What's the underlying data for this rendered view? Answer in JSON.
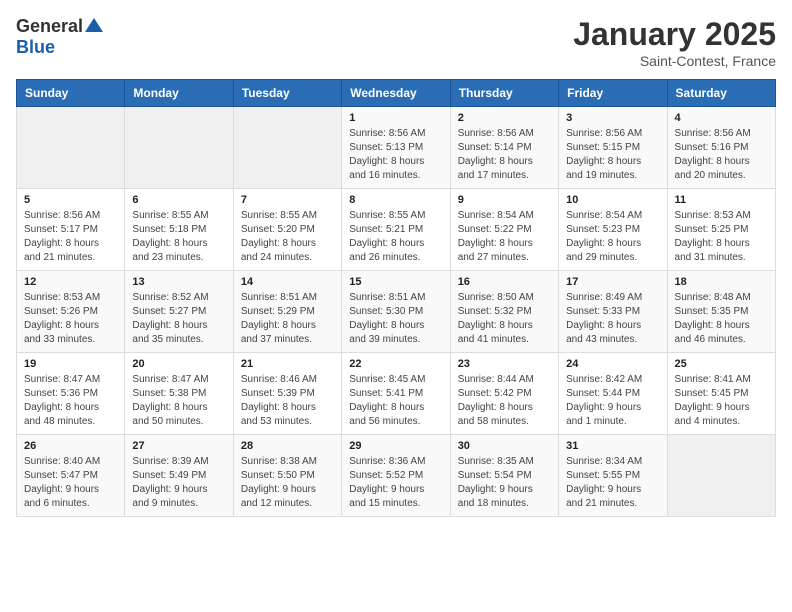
{
  "header": {
    "logo_general": "General",
    "logo_blue": "Blue",
    "month": "January 2025",
    "location": "Saint-Contest, France"
  },
  "days_of_week": [
    "Sunday",
    "Monday",
    "Tuesday",
    "Wednesday",
    "Thursday",
    "Friday",
    "Saturday"
  ],
  "weeks": [
    [
      {
        "day": "",
        "info": ""
      },
      {
        "day": "",
        "info": ""
      },
      {
        "day": "",
        "info": ""
      },
      {
        "day": "1",
        "info": "Sunrise: 8:56 AM\nSunset: 5:13 PM\nDaylight: 8 hours\nand 16 minutes."
      },
      {
        "day": "2",
        "info": "Sunrise: 8:56 AM\nSunset: 5:14 PM\nDaylight: 8 hours\nand 17 minutes."
      },
      {
        "day": "3",
        "info": "Sunrise: 8:56 AM\nSunset: 5:15 PM\nDaylight: 8 hours\nand 19 minutes."
      },
      {
        "day": "4",
        "info": "Sunrise: 8:56 AM\nSunset: 5:16 PM\nDaylight: 8 hours\nand 20 minutes."
      }
    ],
    [
      {
        "day": "5",
        "info": "Sunrise: 8:56 AM\nSunset: 5:17 PM\nDaylight: 8 hours\nand 21 minutes."
      },
      {
        "day": "6",
        "info": "Sunrise: 8:55 AM\nSunset: 5:18 PM\nDaylight: 8 hours\nand 23 minutes."
      },
      {
        "day": "7",
        "info": "Sunrise: 8:55 AM\nSunset: 5:20 PM\nDaylight: 8 hours\nand 24 minutes."
      },
      {
        "day": "8",
        "info": "Sunrise: 8:55 AM\nSunset: 5:21 PM\nDaylight: 8 hours\nand 26 minutes."
      },
      {
        "day": "9",
        "info": "Sunrise: 8:54 AM\nSunset: 5:22 PM\nDaylight: 8 hours\nand 27 minutes."
      },
      {
        "day": "10",
        "info": "Sunrise: 8:54 AM\nSunset: 5:23 PM\nDaylight: 8 hours\nand 29 minutes."
      },
      {
        "day": "11",
        "info": "Sunrise: 8:53 AM\nSunset: 5:25 PM\nDaylight: 8 hours\nand 31 minutes."
      }
    ],
    [
      {
        "day": "12",
        "info": "Sunrise: 8:53 AM\nSunset: 5:26 PM\nDaylight: 8 hours\nand 33 minutes."
      },
      {
        "day": "13",
        "info": "Sunrise: 8:52 AM\nSunset: 5:27 PM\nDaylight: 8 hours\nand 35 minutes."
      },
      {
        "day": "14",
        "info": "Sunrise: 8:51 AM\nSunset: 5:29 PM\nDaylight: 8 hours\nand 37 minutes."
      },
      {
        "day": "15",
        "info": "Sunrise: 8:51 AM\nSunset: 5:30 PM\nDaylight: 8 hours\nand 39 minutes."
      },
      {
        "day": "16",
        "info": "Sunrise: 8:50 AM\nSunset: 5:32 PM\nDaylight: 8 hours\nand 41 minutes."
      },
      {
        "day": "17",
        "info": "Sunrise: 8:49 AM\nSunset: 5:33 PM\nDaylight: 8 hours\nand 43 minutes."
      },
      {
        "day": "18",
        "info": "Sunrise: 8:48 AM\nSunset: 5:35 PM\nDaylight: 8 hours\nand 46 minutes."
      }
    ],
    [
      {
        "day": "19",
        "info": "Sunrise: 8:47 AM\nSunset: 5:36 PM\nDaylight: 8 hours\nand 48 minutes."
      },
      {
        "day": "20",
        "info": "Sunrise: 8:47 AM\nSunset: 5:38 PM\nDaylight: 8 hours\nand 50 minutes."
      },
      {
        "day": "21",
        "info": "Sunrise: 8:46 AM\nSunset: 5:39 PM\nDaylight: 8 hours\nand 53 minutes."
      },
      {
        "day": "22",
        "info": "Sunrise: 8:45 AM\nSunset: 5:41 PM\nDaylight: 8 hours\nand 56 minutes."
      },
      {
        "day": "23",
        "info": "Sunrise: 8:44 AM\nSunset: 5:42 PM\nDaylight: 8 hours\nand 58 minutes."
      },
      {
        "day": "24",
        "info": "Sunrise: 8:42 AM\nSunset: 5:44 PM\nDaylight: 9 hours\nand 1 minute."
      },
      {
        "day": "25",
        "info": "Sunrise: 8:41 AM\nSunset: 5:45 PM\nDaylight: 9 hours\nand 4 minutes."
      }
    ],
    [
      {
        "day": "26",
        "info": "Sunrise: 8:40 AM\nSunset: 5:47 PM\nDaylight: 9 hours\nand 6 minutes."
      },
      {
        "day": "27",
        "info": "Sunrise: 8:39 AM\nSunset: 5:49 PM\nDaylight: 9 hours\nand 9 minutes."
      },
      {
        "day": "28",
        "info": "Sunrise: 8:38 AM\nSunset: 5:50 PM\nDaylight: 9 hours\nand 12 minutes."
      },
      {
        "day": "29",
        "info": "Sunrise: 8:36 AM\nSunset: 5:52 PM\nDaylight: 9 hours\nand 15 minutes."
      },
      {
        "day": "30",
        "info": "Sunrise: 8:35 AM\nSunset: 5:54 PM\nDaylight: 9 hours\nand 18 minutes."
      },
      {
        "day": "31",
        "info": "Sunrise: 8:34 AM\nSunset: 5:55 PM\nDaylight: 9 hours\nand 21 minutes."
      },
      {
        "day": "",
        "info": ""
      }
    ]
  ]
}
